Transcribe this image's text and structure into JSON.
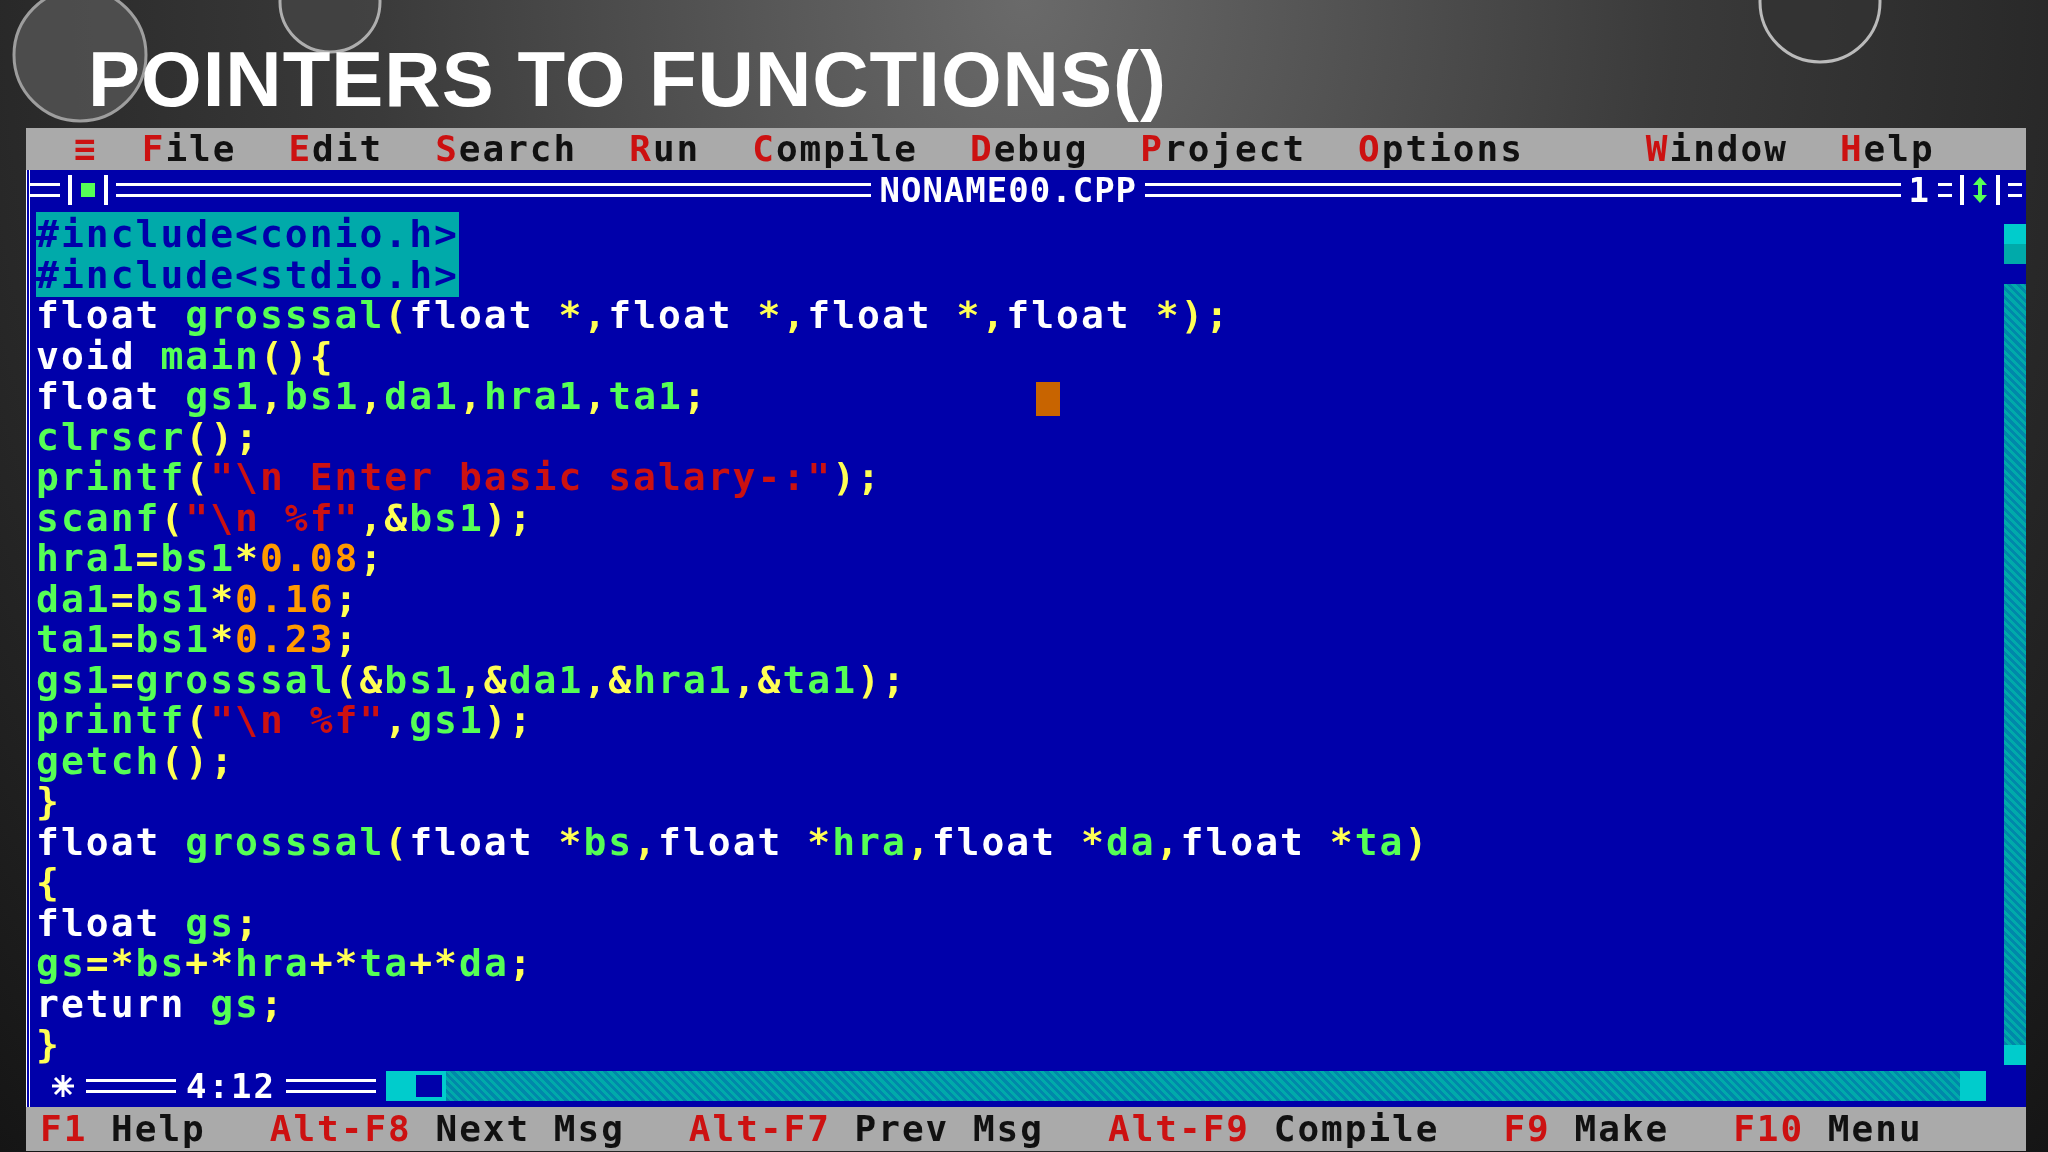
{
  "slide_title": "POINTERS TO FUNCTIONS()",
  "menu": [
    {
      "label": "≡",
      "kind": "system"
    },
    {
      "label": "File",
      "kind": "item"
    },
    {
      "label": "Edit",
      "kind": "item"
    },
    {
      "label": "Search",
      "kind": "item"
    },
    {
      "label": "Run",
      "kind": "item"
    },
    {
      "label": "Compile",
      "kind": "item"
    },
    {
      "label": "Debug",
      "kind": "item"
    },
    {
      "label": "Project",
      "kind": "item"
    },
    {
      "label": "Options",
      "kind": "item"
    },
    {
      "label": "Window",
      "kind": "item"
    },
    {
      "label": "Help",
      "kind": "item"
    }
  ],
  "editor": {
    "title": "NONAME00.CPP",
    "window_number": "1",
    "position": "4:12",
    "lines": [
      {
        "selected": true,
        "cursor": false,
        "tokens": [
          {
            "kind": "sel",
            "text": "#include<conio.h>"
          }
        ]
      },
      {
        "selected": true,
        "cursor": false,
        "tokens": [
          {
            "kind": "sel",
            "text": "#include<stdio.h>"
          }
        ]
      },
      {
        "selected": false,
        "cursor": false,
        "tokens": [
          {
            "kind": "kw",
            "text": "float "
          },
          {
            "kind": "id",
            "text": "grosssal"
          },
          {
            "kind": "sym",
            "text": "("
          },
          {
            "kind": "kw",
            "text": "float "
          },
          {
            "kind": "sym",
            "text": "*,"
          },
          {
            "kind": "kw",
            "text": "float "
          },
          {
            "kind": "sym",
            "text": "*,"
          },
          {
            "kind": "kw",
            "text": "float "
          },
          {
            "kind": "sym",
            "text": "*,"
          },
          {
            "kind": "kw",
            "text": "float "
          },
          {
            "kind": "sym",
            "text": "*);"
          }
        ]
      },
      {
        "selected": false,
        "cursor": false,
        "tokens": [
          {
            "kind": "kw",
            "text": "void "
          },
          {
            "kind": "id",
            "text": "main"
          },
          {
            "kind": "sym",
            "text": "(){"
          }
        ]
      },
      {
        "selected": false,
        "cursor": true,
        "tokens": [
          {
            "kind": "kw",
            "text": "float "
          },
          {
            "kind": "id",
            "text": "gs1"
          },
          {
            "kind": "sym",
            "text": ","
          },
          {
            "kind": "id",
            "text": "bs1"
          },
          {
            "kind": "sym",
            "text": ","
          },
          {
            "kind": "id",
            "text": "da1"
          },
          {
            "kind": "sym",
            "text": ","
          },
          {
            "kind": "id",
            "text": "hra1"
          },
          {
            "kind": "sym",
            "text": ","
          },
          {
            "kind": "id",
            "text": "ta1"
          },
          {
            "kind": "sym",
            "text": ";"
          }
        ]
      },
      {
        "selected": false,
        "cursor": false,
        "tokens": [
          {
            "kind": "id",
            "text": "clrscr"
          },
          {
            "kind": "sym",
            "text": "();"
          }
        ]
      },
      {
        "selected": false,
        "cursor": false,
        "tokens": [
          {
            "kind": "id",
            "text": "printf"
          },
          {
            "kind": "sym",
            "text": "("
          },
          {
            "kind": "str",
            "text": "\"\\n Enter basic salary-:\""
          },
          {
            "kind": "sym",
            "text": ");"
          }
        ]
      },
      {
        "selected": false,
        "cursor": false,
        "tokens": [
          {
            "kind": "id",
            "text": "scanf"
          },
          {
            "kind": "sym",
            "text": "("
          },
          {
            "kind": "str",
            "text": "\"\\n %f\""
          },
          {
            "kind": "sym",
            "text": ",&"
          },
          {
            "kind": "id",
            "text": "bs1"
          },
          {
            "kind": "sym",
            "text": ");"
          }
        ]
      },
      {
        "selected": false,
        "cursor": false,
        "tokens": [
          {
            "kind": "id",
            "text": "hra1"
          },
          {
            "kind": "sym",
            "text": "="
          },
          {
            "kind": "id",
            "text": "bs1"
          },
          {
            "kind": "sym",
            "text": "*"
          },
          {
            "kind": "num",
            "text": "0.08"
          },
          {
            "kind": "sym",
            "text": ";"
          }
        ]
      },
      {
        "selected": false,
        "cursor": false,
        "tokens": [
          {
            "kind": "id",
            "text": "da1"
          },
          {
            "kind": "sym",
            "text": "="
          },
          {
            "kind": "id",
            "text": "bs1"
          },
          {
            "kind": "sym",
            "text": "*"
          },
          {
            "kind": "num",
            "text": "0.16"
          },
          {
            "kind": "sym",
            "text": ";"
          }
        ]
      },
      {
        "selected": false,
        "cursor": false,
        "tokens": [
          {
            "kind": "id",
            "text": "ta1"
          },
          {
            "kind": "sym",
            "text": "="
          },
          {
            "kind": "id",
            "text": "bs1"
          },
          {
            "kind": "sym",
            "text": "*"
          },
          {
            "kind": "num",
            "text": "0.23"
          },
          {
            "kind": "sym",
            "text": ";"
          }
        ]
      },
      {
        "selected": false,
        "cursor": false,
        "tokens": [
          {
            "kind": "id",
            "text": "gs1"
          },
          {
            "kind": "sym",
            "text": "="
          },
          {
            "kind": "id",
            "text": "grosssal"
          },
          {
            "kind": "sym",
            "text": "(&"
          },
          {
            "kind": "id",
            "text": "bs1"
          },
          {
            "kind": "sym",
            "text": ",&"
          },
          {
            "kind": "id",
            "text": "da1"
          },
          {
            "kind": "sym",
            "text": ",&"
          },
          {
            "kind": "id",
            "text": "hra1"
          },
          {
            "kind": "sym",
            "text": ",&"
          },
          {
            "kind": "id",
            "text": "ta1"
          },
          {
            "kind": "sym",
            "text": ");"
          }
        ]
      },
      {
        "selected": false,
        "cursor": false,
        "tokens": [
          {
            "kind": "id",
            "text": "printf"
          },
          {
            "kind": "sym",
            "text": "("
          },
          {
            "kind": "str",
            "text": "\"\\n %f\""
          },
          {
            "kind": "sym",
            "text": ","
          },
          {
            "kind": "id",
            "text": "gs1"
          },
          {
            "kind": "sym",
            "text": ");"
          }
        ]
      },
      {
        "selected": false,
        "cursor": false,
        "tokens": [
          {
            "kind": "id",
            "text": "getch"
          },
          {
            "kind": "sym",
            "text": "();"
          }
        ]
      },
      {
        "selected": false,
        "cursor": false,
        "tokens": [
          {
            "kind": "sym",
            "text": "}"
          }
        ]
      },
      {
        "selected": false,
        "cursor": false,
        "tokens": [
          {
            "kind": "kw",
            "text": "float "
          },
          {
            "kind": "id",
            "text": "grosssal"
          },
          {
            "kind": "sym",
            "text": "("
          },
          {
            "kind": "kw",
            "text": "float "
          },
          {
            "kind": "sym",
            "text": "*"
          },
          {
            "kind": "id",
            "text": "bs"
          },
          {
            "kind": "sym",
            "text": ","
          },
          {
            "kind": "kw",
            "text": "float "
          },
          {
            "kind": "sym",
            "text": "*"
          },
          {
            "kind": "id",
            "text": "hra"
          },
          {
            "kind": "sym",
            "text": ","
          },
          {
            "kind": "kw",
            "text": "float "
          },
          {
            "kind": "sym",
            "text": "*"
          },
          {
            "kind": "id",
            "text": "da"
          },
          {
            "kind": "sym",
            "text": ","
          },
          {
            "kind": "kw",
            "text": "float "
          },
          {
            "kind": "sym",
            "text": "*"
          },
          {
            "kind": "id",
            "text": "ta"
          },
          {
            "kind": "sym",
            "text": ")"
          }
        ]
      },
      {
        "selected": false,
        "cursor": false,
        "tokens": [
          {
            "kind": "sym",
            "text": "{"
          }
        ]
      },
      {
        "selected": false,
        "cursor": false,
        "tokens": [
          {
            "kind": "kw",
            "text": "float "
          },
          {
            "kind": "id",
            "text": "gs"
          },
          {
            "kind": "sym",
            "text": ";"
          }
        ]
      },
      {
        "selected": false,
        "cursor": false,
        "tokens": [
          {
            "kind": "id",
            "text": "gs"
          },
          {
            "kind": "sym",
            "text": "=*"
          },
          {
            "kind": "id",
            "text": "bs"
          },
          {
            "kind": "sym",
            "text": "+*"
          },
          {
            "kind": "id",
            "text": "hra"
          },
          {
            "kind": "sym",
            "text": "+*"
          },
          {
            "kind": "id",
            "text": "ta"
          },
          {
            "kind": "sym",
            "text": "+*"
          },
          {
            "kind": "id",
            "text": "da"
          },
          {
            "kind": "sym",
            "text": ";"
          }
        ]
      },
      {
        "selected": false,
        "cursor": false,
        "tokens": [
          {
            "kind": "kw",
            "text": "return "
          },
          {
            "kind": "id",
            "text": "gs"
          },
          {
            "kind": "sym",
            "text": ";"
          }
        ]
      },
      {
        "selected": false,
        "cursor": false,
        "tokens": [
          {
            "kind": "sym",
            "text": "}"
          }
        ]
      }
    ]
  },
  "function_keys": [
    {
      "key": "F1",
      "label": "Help"
    },
    {
      "key": "Alt-F8",
      "label": "Next Msg"
    },
    {
      "key": "Alt-F7",
      "label": "Prev Msg"
    },
    {
      "key": "Alt-F9",
      "label": "Compile"
    },
    {
      "key": "F9",
      "label": "Make"
    },
    {
      "key": "F10",
      "label": "Menu"
    }
  ]
}
